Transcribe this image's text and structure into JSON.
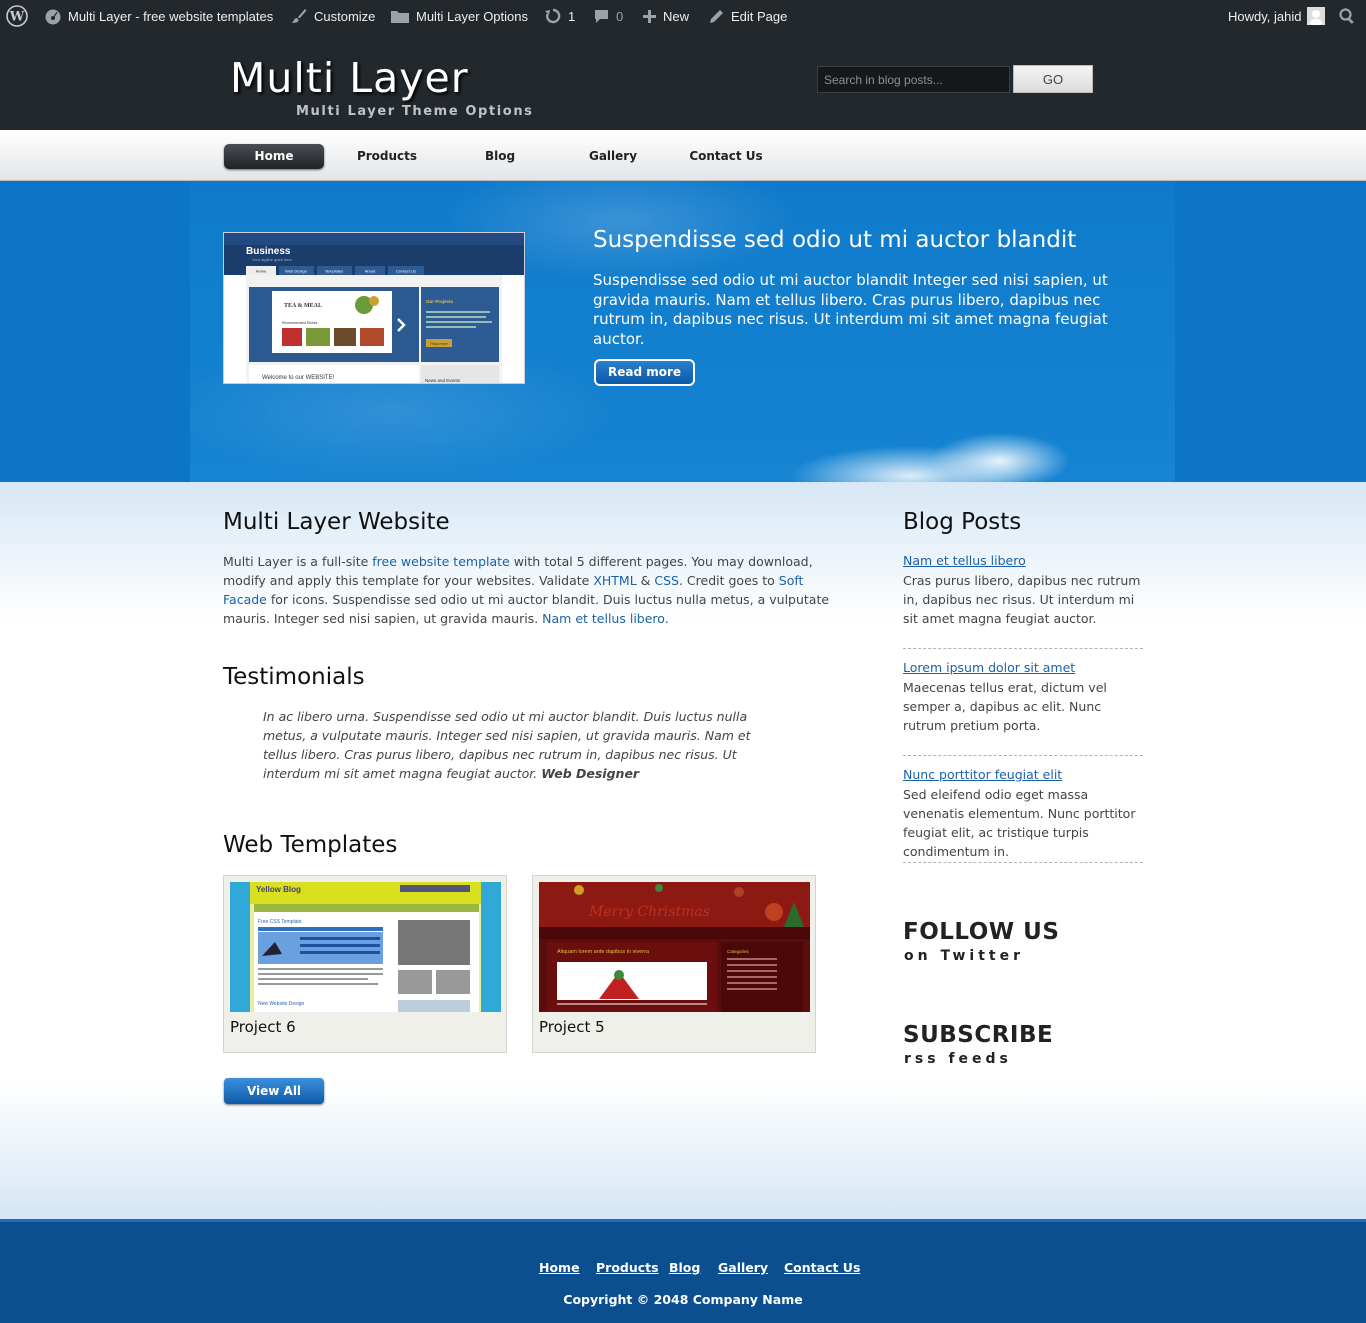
{
  "adminbar": {
    "site_name": "Multi Layer - free website templates",
    "customize": "Customize",
    "options": "Multi Layer Options",
    "updates_count": "1",
    "comments_count": "0",
    "new_label": "New",
    "edit_page": "Edit Page",
    "howdy": "Howdy, jahid"
  },
  "header": {
    "title": "Multi Layer",
    "tagline": "Multi Layer Theme Options",
    "search_placeholder": "Search in blog posts...",
    "search_button": "GO"
  },
  "nav": {
    "items": [
      {
        "label": "Home",
        "active": true
      },
      {
        "label": "Products",
        "active": false
      },
      {
        "label": "Blog",
        "active": false
      },
      {
        "label": "Gallery",
        "active": false
      },
      {
        "label": "Contact Us",
        "active": false
      }
    ]
  },
  "hero": {
    "image": {
      "brand": "Business",
      "slogan": "Your tagline goes here",
      "tabs": [
        "Home",
        "Web Design",
        "Templates",
        "About",
        "Contact Us"
      ],
      "slide_title": "TEA & MEAL",
      "slide_caption": "Recommended Dishes",
      "projects_title": "Our Projects",
      "read_more": "Read more",
      "welcome": "Welcome to our WEBSITE!",
      "news": "News and Events"
    },
    "title": "Suspendisse sed odio ut mi auctor blandit",
    "text": "Suspendisse sed odio ut mi auctor blandit Integer sed nisi sapien, ut gravida mauris. Nam et tellus libero. Cras purus libero, dapibus nec rutrum in, dapibus nec risus. Ut interdum mi sit amet magna feugiat auctor.",
    "button": "Read more"
  },
  "main": {
    "about": {
      "title": "Multi Layer Website",
      "p1": "Multi Layer is a full-site ",
      "link1": "free website template",
      "p2": " with total 5 different pages. You may download, modify and apply this template for your websites. Validate ",
      "link2": "XHTML",
      "amp": " & ",
      "link3": "CSS",
      "p3": ". Credit goes to ",
      "link4": "Soft Facade",
      "p4": " for icons. Suspendisse sed odio ut mi auctor blandit. Duis luctus nulla metus, a vulputate mauris. Integer sed nisi sapien, ut gravida mauris. ",
      "link5": "Nam et tellus libero",
      "p5": "."
    },
    "testimonials": {
      "title": "Testimonials",
      "quote": "In ac libero urna. Suspendisse sed odio ut mi auctor blandit. Duis luctus nulla metus, a vulputate mauris. Integer sed nisi sapien, ut gravida mauris. Nam et tellus libero. Cras purus libero, dapibus nec rutrum in, dapibus nec risus. Ut interdum mi sit amet magna feugiat auctor. ",
      "author": "Web Designer"
    },
    "templates": {
      "title": "Web Templates",
      "items": [
        {
          "caption": "Project 6",
          "thumb_title": "Yellow Blog",
          "thumb_sub": "Free CSS Template",
          "thumb_sub2": "New Website Design"
        },
        {
          "caption": "Project 5",
          "thumb_title": "Merry Christmas",
          "thumb_sub": "Aliquam lorem ante dapibus in viverra",
          "thumb_sub2": "Categories"
        }
      ],
      "view_all": "View All"
    }
  },
  "sidebar": {
    "title": "Blog Posts",
    "posts": [
      {
        "title": "Nam et tellus libero",
        "text": "Cras purus libero, dapibus nec rutrum in, dapibus nec risus. Ut interdum mi sit amet magna feugiat auctor."
      },
      {
        "title": "Lorem ipsum dolor sit amet",
        "text": "Maecenas tellus erat, dictum vel semper a, dapibus ac elit. Nunc rutrum pretium porta."
      },
      {
        "title": "Nunc porttitor feugiat elit",
        "text": "Sed eleifend odio eget massa venenatis elementum. Nunc porttitor feugiat elit, ac tristique turpis condimentum in."
      }
    ],
    "follow": {
      "big": "FOLLOW US",
      "small": "on Twitter"
    },
    "subscribe": {
      "big": "SUBSCRIBE",
      "small": "rss feeds"
    }
  },
  "footer": {
    "links": [
      "Home",
      "Products",
      "Blog",
      "Gallery",
      "Contact Us"
    ],
    "copyright": "Copyright © 2048 Company Name"
  },
  "colors": {
    "adminbar": "#23282d",
    "hero_blue": "#0d75c8",
    "footer_blue": "#0c4f91",
    "link": "#1a62a8"
  }
}
